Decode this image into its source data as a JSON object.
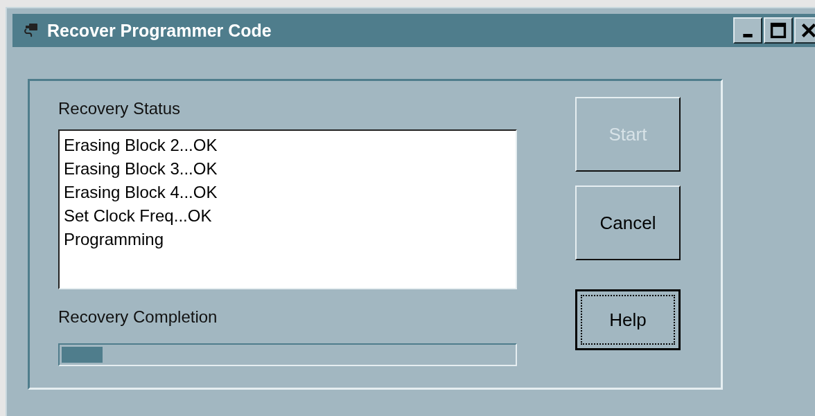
{
  "window": {
    "title": "Recover Programmer Code"
  },
  "status_group": {
    "label": "Recovery Status",
    "log": [
      "Erasing Block 2...OK",
      "Erasing Block 3...OK",
      "Erasing Block 4...OK",
      "Set Clock Freq...OK",
      "Programming"
    ]
  },
  "completion": {
    "label": "Recovery Completion",
    "level": 0.09
  },
  "buttons": [
    {
      "label": "Start",
      "disabled": true,
      "focused": false
    },
    {
      "label": "Cancel",
      "disabled": false,
      "focused": false
    },
    {
      "label": "Help",
      "disabled": false,
      "focused": true
    }
  ]
}
